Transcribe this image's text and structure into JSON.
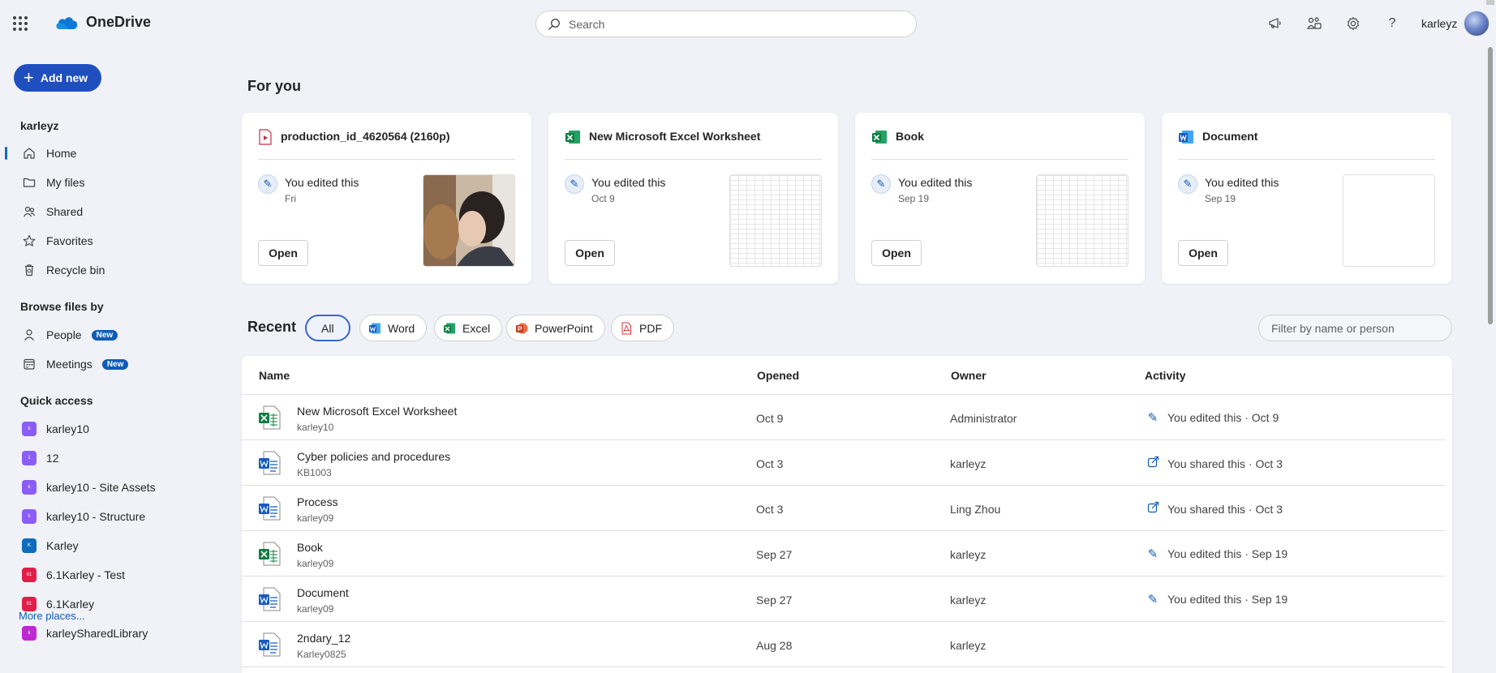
{
  "app": {
    "title": "OneDrive",
    "user": "karleyz"
  },
  "search": {
    "placeholder": "Search"
  },
  "header_icons": [
    "megaphone-icon",
    "share-network-icon",
    "gear-icon",
    "help-icon"
  ],
  "sidebar": {
    "add_new": "Add new",
    "account": "karleyz",
    "nav": [
      {
        "label": "Home",
        "icon": "home-icon",
        "active": true
      },
      {
        "label": "My files",
        "icon": "folder-icon"
      },
      {
        "label": "Shared",
        "icon": "people-icon"
      },
      {
        "label": "Favorites",
        "icon": "star-icon"
      },
      {
        "label": "Recycle bin",
        "icon": "recycle-bin-icon"
      }
    ],
    "browse_title": "Browse files by",
    "browse": [
      {
        "label": "People",
        "badge": "New",
        "icon": "person-icon"
      },
      {
        "label": "Meetings",
        "badge": "New",
        "icon": "calendar-icon"
      }
    ],
    "quick_access_title": "Quick access",
    "quick_access": [
      {
        "label": "karley10",
        "color": "#8b5cf6",
        "initials": "k"
      },
      {
        "label": "12",
        "color": "#8b5cf6",
        "initials": "1"
      },
      {
        "label": "karley10 - Site Assets",
        "color": "#8b5cf6",
        "initials": "k"
      },
      {
        "label": "karley10 - Structure",
        "color": "#8b5cf6",
        "initials": "k"
      },
      {
        "label": "Karley",
        "color": "#0f6cbd",
        "initials": "K"
      },
      {
        "label": "6.1Karley - Test",
        "color": "#e11d48",
        "initials": "61"
      },
      {
        "label": "6.1Karley",
        "color": "#e11d48",
        "initials": "61"
      },
      {
        "label": "karleySharedLibrary",
        "color": "#c026d3",
        "initials": "k"
      }
    ],
    "more_places": "More places..."
  },
  "for_you": {
    "title": "For you",
    "cards": [
      {
        "title": "production_id_4620564 (2160p)",
        "type": "video",
        "activity": "You edited this",
        "date": "Fri",
        "open": "Open"
      },
      {
        "title": "New Microsoft Excel Worksheet",
        "type": "excel",
        "activity": "You edited this",
        "date": "Oct 9",
        "open": "Open"
      },
      {
        "title": "Book",
        "type": "excel",
        "activity": "You edited this",
        "date": "Sep 19",
        "open": "Open"
      },
      {
        "title": "Document",
        "type": "word",
        "activity": "You edited this",
        "date": "Sep 19",
        "open": "Open"
      }
    ]
  },
  "recent": {
    "title": "Recent",
    "filters": [
      "All",
      "Word",
      "Excel",
      "PowerPoint",
      "PDF"
    ],
    "filter_placeholder": "Filter by name or person",
    "columns": [
      "Name",
      "Opened",
      "Owner",
      "Activity"
    ],
    "rows": [
      {
        "name": "New Microsoft Excel Worksheet",
        "location": "karley10",
        "type": "excel",
        "opened": "Oct 9",
        "owner": "Administrator",
        "activity": "You edited this · Oct 9",
        "activity_icon": "pencil-icon"
      },
      {
        "name": "Cyber policies and procedures",
        "location": "KB1003",
        "type": "word",
        "opened": "Oct 3",
        "owner": "karleyz",
        "activity": "You shared this · Oct 3",
        "activity_icon": "share-icon"
      },
      {
        "name": "Process",
        "location": "karley09",
        "type": "word",
        "opened": "Oct 3",
        "owner": "Ling Zhou",
        "activity": "You shared this · Oct 3",
        "activity_icon": "share-icon"
      },
      {
        "name": "Book",
        "location": "karley09",
        "type": "excel",
        "opened": "Sep 27",
        "owner": "karleyz",
        "activity": "You edited this · Sep 19",
        "activity_icon": "pencil-icon"
      },
      {
        "name": "Document",
        "location": "karley09",
        "type": "word",
        "opened": "Sep 27",
        "owner": "karleyz",
        "activity": "You edited this · Sep 19",
        "activity_icon": "pencil-icon"
      },
      {
        "name": "2ndary_12",
        "location": "Karley0825",
        "type": "word",
        "opened": "Aug 28",
        "owner": "karleyz",
        "activity": "",
        "activity_icon": ""
      }
    ]
  },
  "colors": {
    "accent": "#1f4fbf",
    "word": "#185abd",
    "excel": "#107c41",
    "powerpoint": "#c43e1c",
    "pdf": "#d13438",
    "video": "#c4314b"
  }
}
